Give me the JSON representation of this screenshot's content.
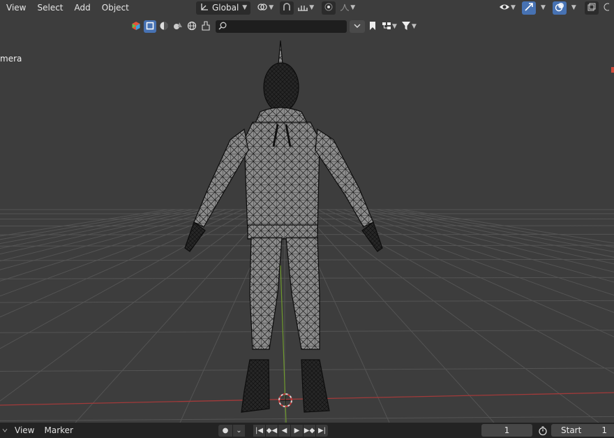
{
  "header": {
    "menu": [
      "View",
      "Select",
      "Add",
      "Object"
    ],
    "transform_orientation": "Global"
  },
  "viewport": {
    "camera_label": "mera",
    "search_placeholder": ""
  },
  "timeline": {
    "menu": [
      "View",
      "Marker"
    ],
    "current_frame": "1",
    "start_label": "Start",
    "start_value": "1"
  },
  "icons": {
    "orientation": "transform-orientation-icon",
    "pivot": "pivot-point-icon",
    "snap": "snap-icon",
    "snap_increment": "snap-increment-icon",
    "proportional": "proportional-editing-icon",
    "falloff": "falloff-curve-icon",
    "visibility": "object-visibility-icon",
    "gizmo": "gizmo-toggle-icon",
    "overlay": "overlay-toggle-icon",
    "xray": "xray-toggle-icon"
  },
  "colors": {
    "accent": "#4772b3",
    "x_axis": "#a23a3a",
    "y_axis": "#6f9a2d",
    "grid": "#545454",
    "background": "#3d3d3d"
  }
}
